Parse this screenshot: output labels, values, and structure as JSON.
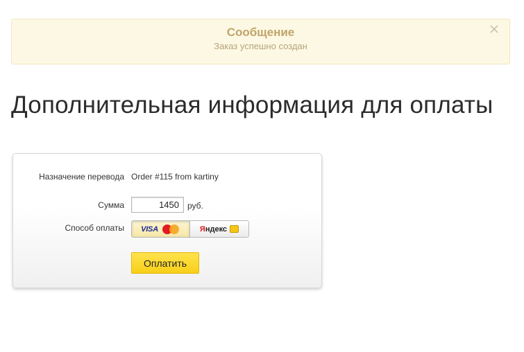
{
  "alert": {
    "title": "Сообщение",
    "text": "Заказ успешно создан",
    "close_icon": "close-x",
    "background_color": "#fcf8e3",
    "title_color": "#c0a46b"
  },
  "page": {
    "title": "Дополнительная информация для оплаты"
  },
  "payment_form": {
    "purpose_label": "Назначение перевода",
    "purpose_value": "Order #115 from kartiny",
    "amount_label": "Сумма",
    "amount_value": "1450",
    "currency": "руб.",
    "method_label": "Способ оплаты",
    "methods": [
      {
        "id": "card",
        "label": "VISA",
        "icons": [
          "visa-logo",
          "mastercard-logo"
        ],
        "selected": true
      },
      {
        "id": "yandex",
        "label_red": "Я",
        "label_rest": "ндекс",
        "icons": [
          "yandex-wallet-icon"
        ],
        "selected": false
      }
    ],
    "submit_label": "Оплатить",
    "submit_color": "#f8cf17"
  }
}
